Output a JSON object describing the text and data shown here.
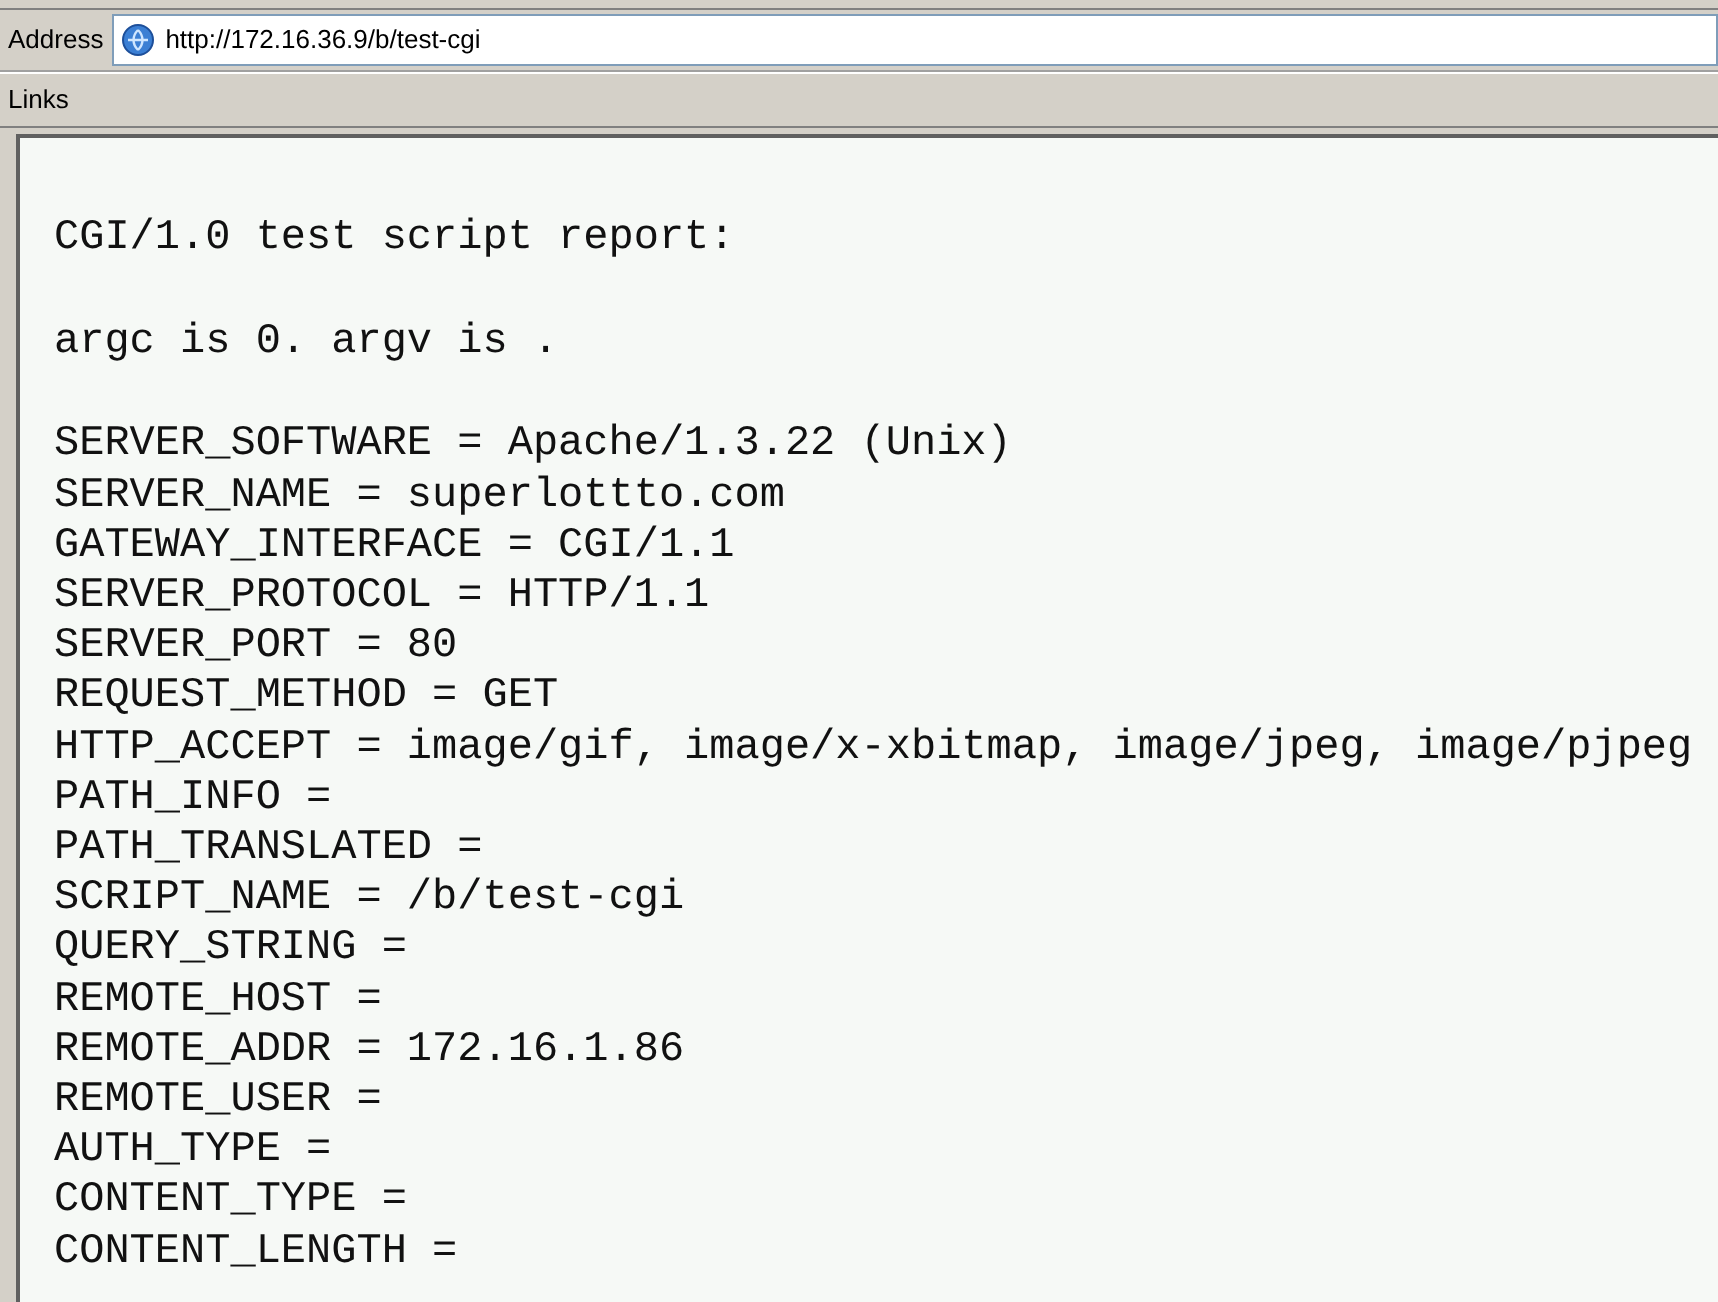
{
  "address_bar": {
    "label": "Address",
    "url": "http://172.16.36.9/b/test-cgi"
  },
  "links_bar": {
    "label": "Links"
  },
  "page": {
    "heading": "CGI/1.0 test script report:",
    "args_line": "argc is 0. argv is .",
    "env_lines": [
      "SERVER_SOFTWARE = Apache/1.3.22 (Unix)",
      "SERVER_NAME = superlottto.com",
      "GATEWAY_INTERFACE = CGI/1.1",
      "SERVER_PROTOCOL = HTTP/1.1",
      "SERVER_PORT = 80",
      "REQUEST_METHOD = GET",
      "HTTP_ACCEPT = image/gif, image/x-xbitmap, image/jpeg, image/pjpeg",
      "PATH_INFO =",
      "PATH_TRANSLATED =",
      "SCRIPT_NAME = /b/test-cgi",
      "QUERY_STRING =",
      "REMOTE_HOST =",
      "REMOTE_ADDR = 172.16.1.86",
      "REMOTE_USER =",
      "AUTH_TYPE =",
      "CONTENT_TYPE =",
      "CONTENT_LENGTH ="
    ]
  }
}
